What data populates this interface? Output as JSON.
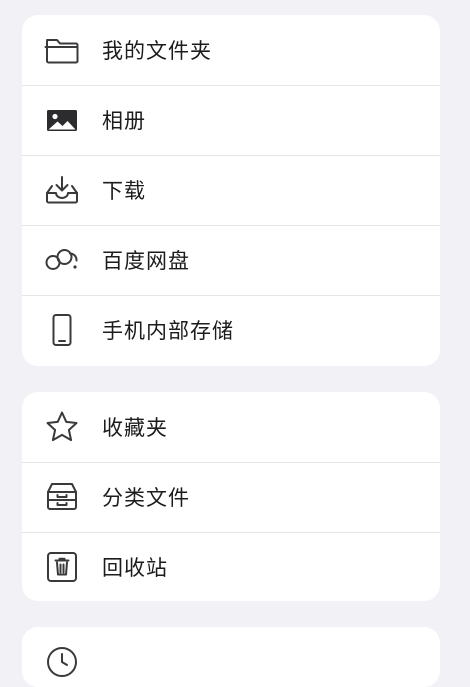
{
  "sections": [
    {
      "items": [
        {
          "label": "我的文件夹",
          "icon": "folder-icon"
        },
        {
          "label": "相册",
          "icon": "photo-album-icon"
        },
        {
          "label": "下载",
          "icon": "download-tray-icon"
        },
        {
          "label": "百度网盘",
          "icon": "baidu-netdisk-icon"
        },
        {
          "label": "手机内部存储",
          "icon": "phone-storage-icon"
        }
      ]
    },
    {
      "items": [
        {
          "label": "收藏夹",
          "icon": "star-icon"
        },
        {
          "label": "分类文件",
          "icon": "archive-box-icon"
        },
        {
          "label": "回收站",
          "icon": "trash-icon"
        }
      ]
    },
    {
      "items": [
        {
          "label": "",
          "icon": "clock-icon"
        }
      ]
    }
  ],
  "colors": {
    "background": "#f2f2f6",
    "card": "#ffffff",
    "text": "#1c1c1e",
    "icon": "#3a3a3c",
    "divider": "#e6e6ea"
  }
}
